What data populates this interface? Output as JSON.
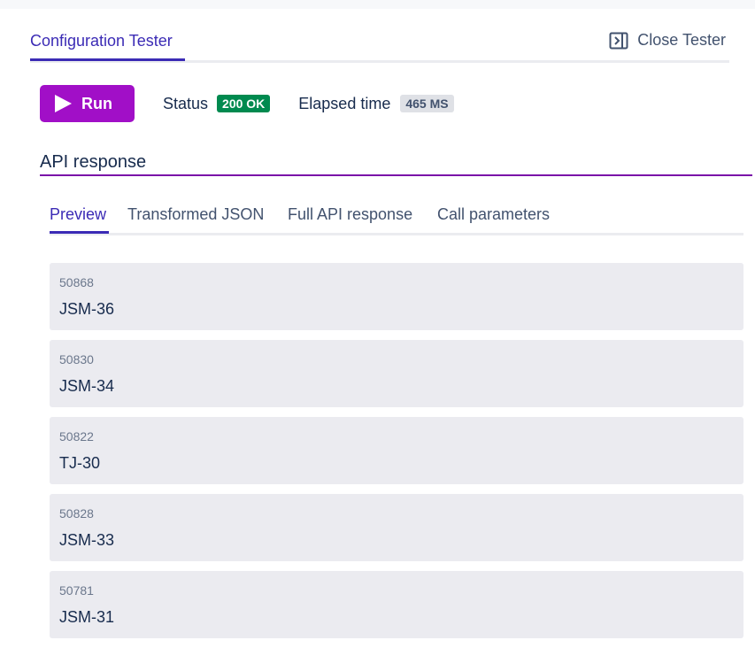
{
  "header": {
    "tab_label": "Configuration Tester",
    "close_label": "Close Tester",
    "close_icon": "panel-close-icon"
  },
  "controls": {
    "run_label": "Run",
    "run_icon": "play-icon",
    "status_label": "Status",
    "status_value": "200 OK",
    "elapsed_label": "Elapsed time",
    "elapsed_value": "465 MS"
  },
  "section": {
    "title": "API response"
  },
  "tabs": [
    {
      "label": "Preview",
      "active": true
    },
    {
      "label": "Transformed JSON",
      "active": false
    },
    {
      "label": "Full API response",
      "active": false
    },
    {
      "label": "Call parameters",
      "active": false
    }
  ],
  "results": [
    {
      "id": "50868",
      "key": "JSM-36"
    },
    {
      "id": "50830",
      "key": "JSM-34"
    },
    {
      "id": "50822",
      "key": "TJ-30"
    },
    {
      "id": "50828",
      "key": "JSM-33"
    },
    {
      "id": "50781",
      "key": "JSM-31"
    }
  ],
  "colors": {
    "accent": "#3b2bb5",
    "run_button": "#a10fc7",
    "status_ok": "#008a4f",
    "section_rule": "#7a11a8",
    "card_bg": "#ebebf0"
  }
}
